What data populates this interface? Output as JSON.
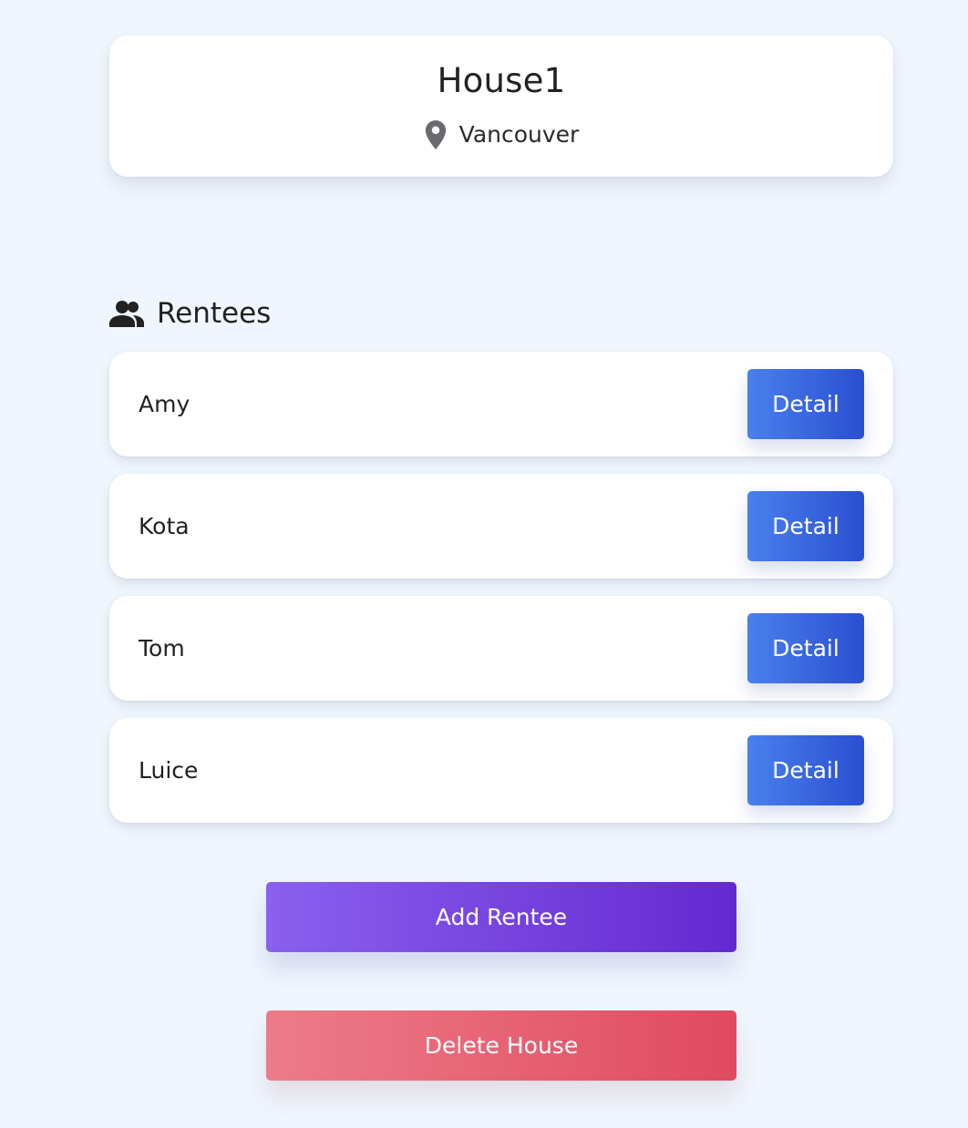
{
  "house": {
    "name": "House1",
    "location": "Vancouver",
    "location_icon": "map-pin-icon"
  },
  "rentees": {
    "heading": "Rentees",
    "heading_icon": "people-icon",
    "items": [
      {
        "name": "Amy",
        "detail_label": "Detail"
      },
      {
        "name": "Kota",
        "detail_label": "Detail"
      },
      {
        "name": "Tom",
        "detail_label": "Detail"
      },
      {
        "name": "Luice",
        "detail_label": "Detail"
      }
    ]
  },
  "actions": {
    "add_label": "Add Rentee",
    "delete_label": "Delete House"
  },
  "colors": {
    "background": "#eff6fe",
    "detail_button": "#3a67e0",
    "add_button": "#7544e0",
    "delete_button": "#e65f72"
  }
}
